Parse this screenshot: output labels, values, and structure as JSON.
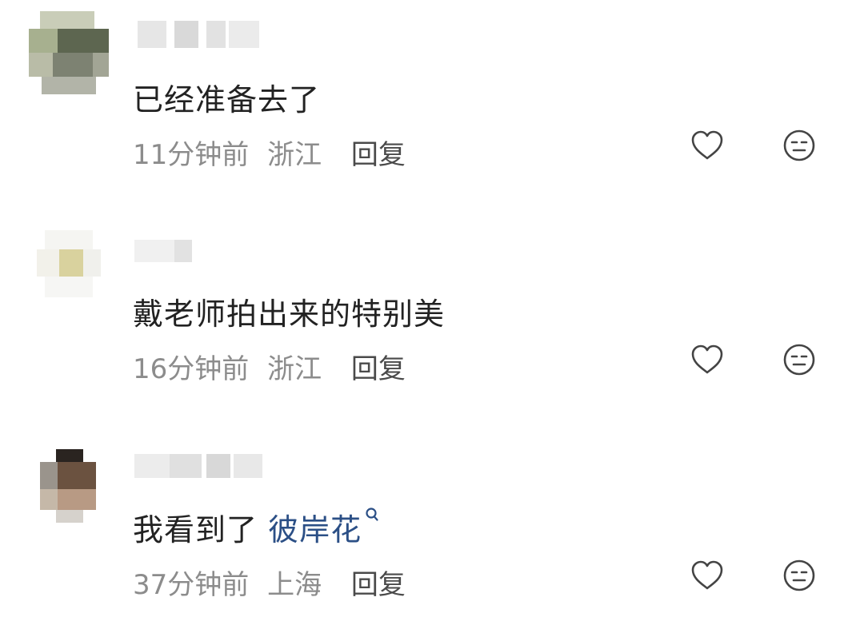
{
  "comments": [
    {
      "text": "已经准备去了",
      "link": "",
      "time": "11分钟前",
      "location": "浙江",
      "reply_label": "回复"
    },
    {
      "text": "戴老师拍出来的特别美",
      "link": "",
      "time": "16分钟前",
      "location": "浙江",
      "reply_label": "回复"
    },
    {
      "text": "我看到了 ",
      "link": "彼岸花",
      "time": "37分钟前",
      "location": "上海",
      "reply_label": "回复"
    }
  ],
  "icons": {
    "like": "heart-outline-icon",
    "reaction": "neutral-face-icon",
    "search": "search-icon"
  },
  "colors": {
    "text": "#222222",
    "meta": "#8c8c8c",
    "reply": "#4a4a4a",
    "link": "#2b4f86",
    "icon": "#444444"
  }
}
